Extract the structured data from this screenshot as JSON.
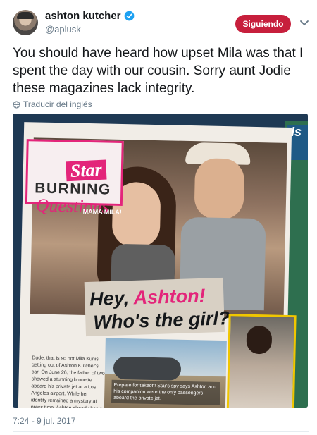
{
  "author": {
    "name": "ashton kutcher",
    "handle": "@aplusk",
    "verified": true
  },
  "follow_button": {
    "label": "Siguiendo",
    "color": "#c71f3c"
  },
  "tweet": {
    "text": "You should have heard how upset Mila was that I spent the day with our cousin. Sorry aunt Jodie these magazines lack integrity.",
    "translate_label": "Traducir del inglés",
    "timestamp": "7:24 - 9 jul. 2017"
  },
  "magazine": {
    "logo": "Star",
    "kicker_top": "BURNING",
    "kicker_bottom": "Questions",
    "photo_label": "MAMA MILA!",
    "headline_part1": "Hey, ",
    "headline_name": "Ashton!",
    "headline_line2": "Who's the girl?",
    "side_letters": "Is",
    "body_text": "Dude, that is so not Mila Kunis getting out of Ashton Kutcher's car! On June 26, the father of two showed a stunning brunette aboard his private jet at a Los Angeles airport. While her identity remained a mystery at press time, Ashton already has a lot of baggage to claim. As Star previously reported, Ashton and Mila's marriage was",
    "caption": "Prepare for takeoff! Star's spy says Ashton and his companion were the only passengers aboard the private jet."
  },
  "colors": {
    "accent": "#1da1f2",
    "magazine_pink": "#e3257a",
    "text_secondary": "#657786"
  },
  "icons": {
    "verified": "verified-badge-icon",
    "menu": "chevron-down-icon",
    "translate": "globe-icon"
  }
}
